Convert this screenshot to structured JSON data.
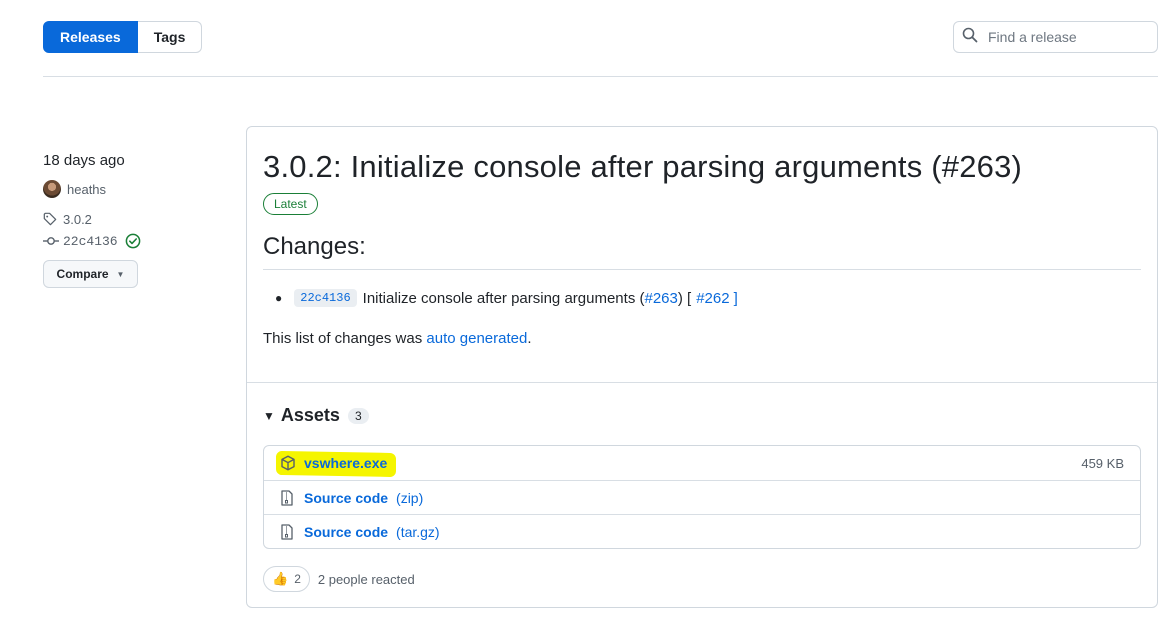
{
  "toolbar": {
    "releases_label": "Releases",
    "tags_label": "Tags",
    "search_placeholder": "Find a release"
  },
  "meta": {
    "date": "18 days ago",
    "author": "heaths",
    "tag": "3.0.2",
    "commit": "22c4136",
    "compare_label": "Compare"
  },
  "release": {
    "title": "3.0.2: Initialize console after parsing arguments (#263)",
    "badge": "Latest",
    "changes_heading": "Changes:",
    "change": {
      "sha": "22c4136",
      "text": "Initialize console after parsing arguments (",
      "pr_link": "#263",
      "mid": ") [",
      "issue_link": "#262",
      "end": "]"
    },
    "autogen_prefix": "This list of changes was ",
    "autogen_link": "auto generated",
    "autogen_suffix": "."
  },
  "assets": {
    "heading": "Assets",
    "count": "3",
    "items": [
      {
        "name": "vswhere.exe",
        "ext": "",
        "size": "459 KB"
      },
      {
        "name": "Source code",
        "ext": "(zip)",
        "size": ""
      },
      {
        "name": "Source code",
        "ext": "(tar.gz)",
        "size": ""
      }
    ]
  },
  "reactions": {
    "emoji": "👍",
    "count": "2",
    "text": "2 people reacted"
  },
  "colors": {
    "accent": "#0969da",
    "success": "#1a7f37",
    "highlight": "#f5f500"
  }
}
